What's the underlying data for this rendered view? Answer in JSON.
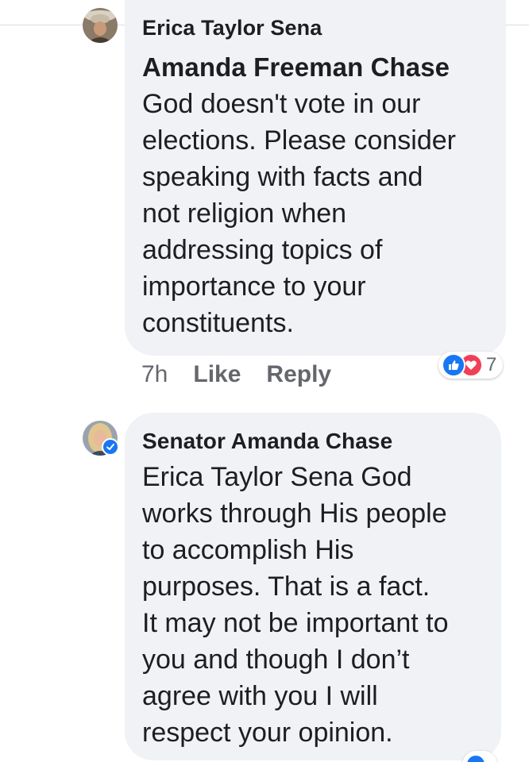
{
  "comments": [
    {
      "author": "Erica Taylor Sena",
      "mention": "Amanda Freeman Chase",
      "text": "God doesn't vote in our\nelections. Please consider\nspeaking with facts and\nnot religion when\naddressing topics of\nimportance to your\nconstituents.",
      "time": "7h",
      "like_label": "Like",
      "reply_label": "Reply",
      "reaction_count": "7",
      "reactions": [
        "like-icon",
        "love-icon"
      ]
    },
    {
      "author": "Senator Amanda Chase",
      "verified": true,
      "text": "Erica Taylor Sena God\nworks through His people\nto accomplish His\npurposes.  That is a fact.\nIt may not be important to\nyou and though I don’t\nagree with you I will\nrespect your opinion.",
      "reactions": [
        "like-icon"
      ]
    }
  ],
  "colors": {
    "bubble": "#f0f2f5",
    "secondary_text": "#65676b",
    "like_blue": "#1877f2",
    "love_red": "#f33e58"
  }
}
